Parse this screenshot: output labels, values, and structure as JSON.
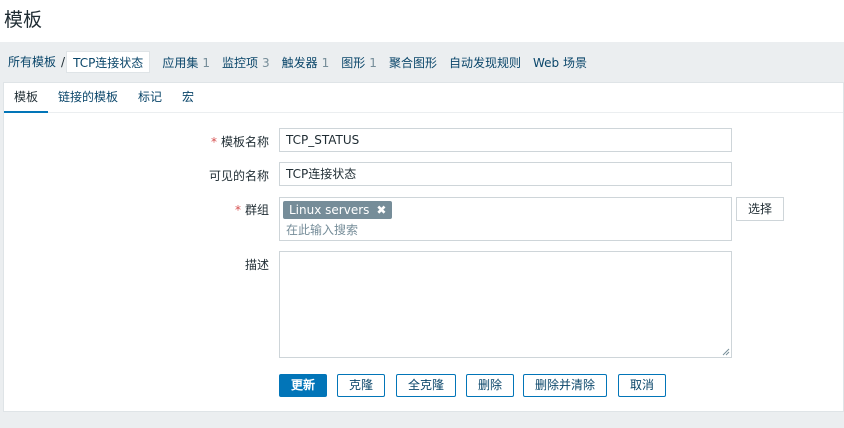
{
  "page": {
    "title": "模板"
  },
  "breadcrumb": {
    "root": "所有模板",
    "separator": "/",
    "current": "TCP连接状态"
  },
  "nav": [
    {
      "label": "应用集",
      "count": "1"
    },
    {
      "label": "监控项",
      "count": "3"
    },
    {
      "label": "触发器",
      "count": "1"
    },
    {
      "label": "图形",
      "count": "1"
    },
    {
      "label": "聚合图形",
      "count": ""
    },
    {
      "label": "自动发现规则",
      "count": ""
    },
    {
      "label": "Web 场景",
      "count": ""
    }
  ],
  "tabs": [
    {
      "label": "模板",
      "active": true
    },
    {
      "label": "链接的模板",
      "active": false
    },
    {
      "label": "标记",
      "active": false
    },
    {
      "label": "宏",
      "active": false
    }
  ],
  "form": {
    "required_mark": "*",
    "template_name": {
      "label": "模板名称",
      "value": "TCP_STATUS"
    },
    "visible_name": {
      "label": "可见的名称",
      "value": "TCP连接状态"
    },
    "groups": {
      "label": "群组",
      "chip": "Linux servers",
      "placeholder": "在此输入搜索",
      "select_label": "选择"
    },
    "description": {
      "label": "描述",
      "value": ""
    }
  },
  "actions": {
    "update": "更新",
    "clone": "克隆",
    "full_clone": "全克隆",
    "delete": "删除",
    "delete_clear": "删除并清除",
    "cancel": "取消"
  },
  "colors": {
    "accent": "#0275b8",
    "link": "#0a466a",
    "required": "#d64e4e",
    "chip": "#768d99"
  }
}
